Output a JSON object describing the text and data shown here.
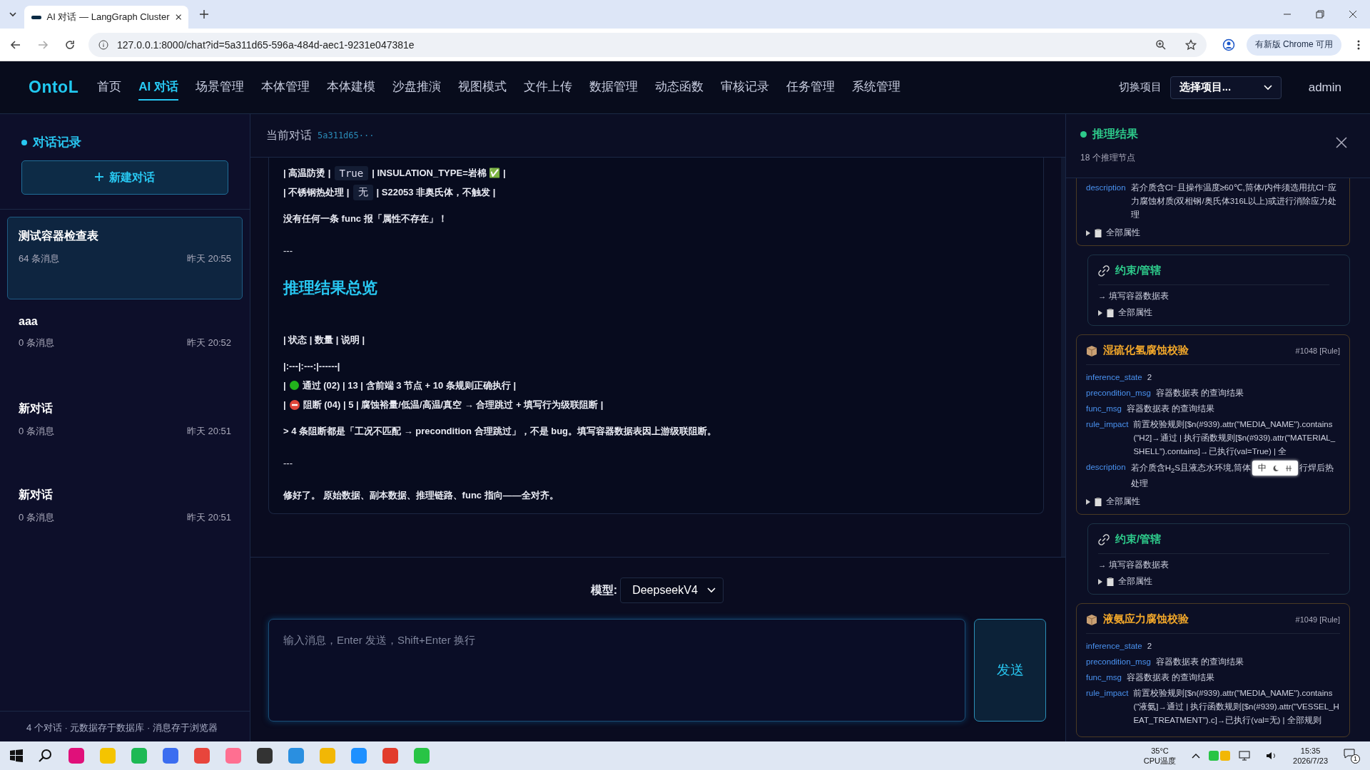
{
  "browser": {
    "tab_title": "AI 对话 — LangGraph Cluster",
    "url": "127.0.0.1:8000/chat?id=5a311d65-596a-484d-aec1-9231e047381e",
    "update_button": "有新版 Chrome 可用"
  },
  "nav": {
    "logo": "OntoL",
    "items": [
      {
        "label": "首页",
        "selected": false
      },
      {
        "label": "AI 对话",
        "selected": true
      },
      {
        "label": "场景管理",
        "selected": false
      },
      {
        "label": "本体管理",
        "selected": false
      },
      {
        "label": "本体建模",
        "selected": false
      },
      {
        "label": "沙盘推演",
        "selected": false
      },
      {
        "label": "视图模式",
        "selected": false
      },
      {
        "label": "文件上传",
        "selected": false
      },
      {
        "label": "数据管理",
        "selected": false
      },
      {
        "label": "动态函数",
        "selected": false
      },
      {
        "label": "审核记录",
        "selected": false
      },
      {
        "label": "任务管理",
        "selected": false
      },
      {
        "label": "系统管理",
        "selected": false
      }
    ],
    "project_label": "切换项目",
    "project_select": "选择项目...",
    "user": "admin"
  },
  "sidebar": {
    "title": "对话记录",
    "new_button": "新建对话",
    "conversations": [
      {
        "title": "测试容器检查表",
        "count": "64 条消息",
        "time": "昨天 20:55",
        "selected": true
      },
      {
        "title": "aaa",
        "count": "0 条消息",
        "time": "昨天 20:52",
        "selected": false
      },
      {
        "title": "新对话",
        "count": "0 条消息",
        "time": "昨天 20:51",
        "selected": false
      },
      {
        "title": "新对话",
        "count": "0 条消息",
        "time": "昨天 20:51",
        "selected": false
      }
    ],
    "footer": "4 个对话 · 元数据存于数据库 · 消息存于浏览器"
  },
  "chat": {
    "header_label": "当前对话",
    "header_id": "5a311d65···",
    "lines": [
      {
        "kind": "code_row",
        "before": "| 高温防烫 |",
        "code": "True",
        "after": "| INSULATION_TYPE=岩棉 ✅ |"
      },
      {
        "kind": "code_row",
        "before": "| 不锈钢热处理 |",
        "code": "无",
        "after": "| S22053 非奥氏体，不触发 |"
      },
      {
        "kind": "text",
        "text": "没有任何一条 func 报「属性不存在」！"
      },
      {
        "kind": "rule",
        "text": "---"
      },
      {
        "kind": "heading",
        "text": "推理结果总览"
      },
      {
        "kind": "text",
        "text": "| 状态 | 数量 | 说明 |"
      },
      {
        "kind": "text",
        "text": "|:---|:---:|------|"
      },
      {
        "kind": "pass_row",
        "before": "|",
        "text": "通过 (02) | 13 | 含前端 3 节点 + 10 条规则正确执行 |"
      },
      {
        "kind": "blocked_row",
        "before": "|",
        "text": "阻断 (04) | 5 | 腐蚀裕量/低温/高温/真空 → 合理跳过 + 填写行为级联阻断 |"
      },
      {
        "kind": "text",
        "text": "> 4 条阻断都是「工况不匹配 → precondition 合理跳过」，不是 bug。填写容器数据表因上游级联阻断。"
      },
      {
        "kind": "rule",
        "text": "---"
      },
      {
        "kind": "text",
        "text": "修好了。 原始数据、副本数据、推理链路、func 指向——全对齐。"
      }
    ],
    "model_label": "模型:",
    "model": "DeepseekV4",
    "input_placeholder": "输入消息，Enter 发送，Shift+Enter 换行",
    "send_button": "发送"
  },
  "panel": {
    "title": "推理结果",
    "subtitle": "18 个推理节点",
    "cards": [
      {
        "kind": "rule_tail",
        "fields": [
          {
            "key": "description",
            "value": "若介质含Cl⁻且操作温度≥60℃,筒体/内件须选用抗Cl⁻应力腐蚀材质(双相钢/奥氏体316L以上)或进行消除应力处理"
          }
        ],
        "footer": "全部属性"
      },
      {
        "kind": "constraint",
        "title": "约束/管辖",
        "target": "→ 填写容器数据表",
        "footer": "全部属性"
      },
      {
        "kind": "rule",
        "title": "湿硫化氢腐蚀校验",
        "tag": "#1048 [Rule]",
        "fields": [
          {
            "key": "inference_state",
            "value": "2"
          },
          {
            "key": "precondition_msg",
            "value": "容器数据表 的查询结果"
          },
          {
            "key": "func_msg",
            "value": "容器数据表 的查询结果"
          },
          {
            "key": "rule_impact",
            "value": "前置校验规则[$n(#939).attr(\"MEDIA_NAME\").contains(\"H2]→通过 | 执行函数规则[$n(#939).attr(\"MATERIAL_SHELL\").contains]→已执行(val=True) | 全"
          },
          {
            "key": "description",
            "value": "若介质含H$_{2}$S且液态水环境,筒体",
            "ime": "中",
            "after": "行焊后热处理"
          }
        ],
        "footer": "全部属性"
      },
      {
        "kind": "constraint",
        "title": "约束/管辖",
        "target": "→ 填写容器数据表",
        "footer": "全部属性"
      },
      {
        "kind": "rule",
        "title": "液氨应力腐蚀校验",
        "tag": "#1049 [Rule]",
        "fields": [
          {
            "key": "inference_state",
            "value": "2"
          },
          {
            "key": "precondition_msg",
            "value": "容器数据表 的查询结果"
          },
          {
            "key": "func_msg",
            "value": "容器数据表 的查询结果"
          },
          {
            "key": "rule_impact",
            "value": "前置校验规则[$n(#939).attr(\"MEDIA_NAME\").contains(\"液氨]→通过 | 执行函数规则[$n(#939).attr(\"VESSEL_HEAT_TREATMENT\").c]→已执行(val=无) | 全部规则"
          }
        ]
      }
    ]
  },
  "taskbar": {
    "temperature": "35°C",
    "temperature_label": "CPU温度",
    "time": "15:35",
    "date": "2026/7/23",
    "notifications": "1"
  }
}
